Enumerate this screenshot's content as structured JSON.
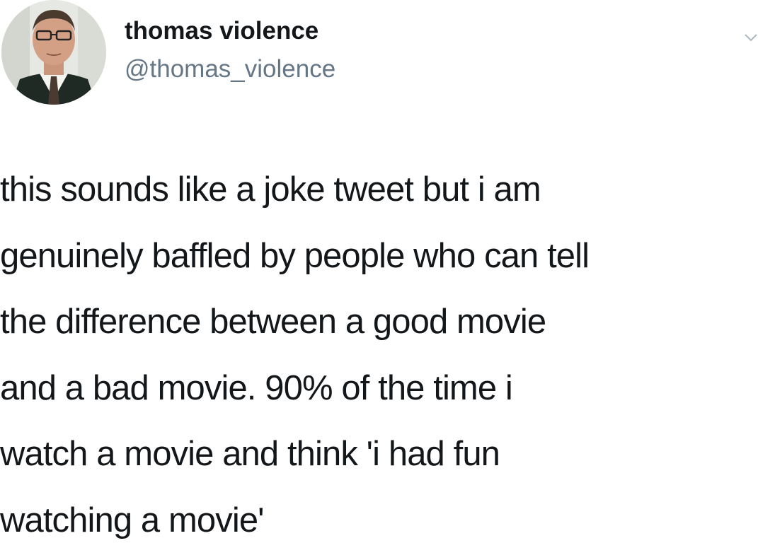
{
  "author": {
    "display_name": "thomas violence",
    "handle": "@thomas_violence",
    "avatar_icon": "profile-photo"
  },
  "menu": {
    "icon": "chevron-down-icon"
  },
  "tweet": {
    "lines": [
      "this sounds like a joke tweet but i am",
      "genuinely baffled by people who can tell",
      "the difference between a good movie",
      "and a bad movie. 90% of the time i",
      "watch a movie and think 'i had fun",
      "watching a movie'"
    ]
  },
  "colors": {
    "text": "#14171a",
    "handle": "#657786",
    "background": "#ffffff"
  }
}
